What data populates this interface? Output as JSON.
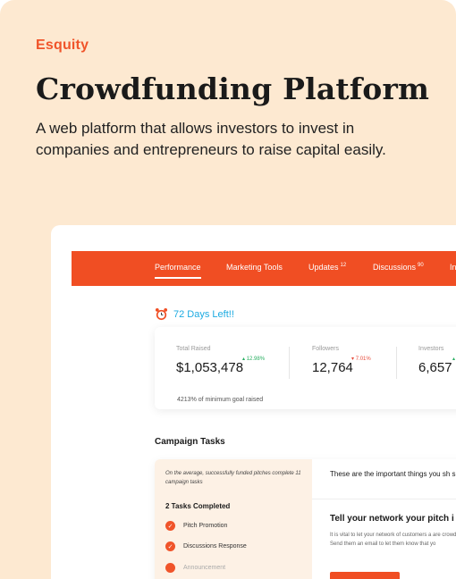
{
  "brand": {
    "logo": "Esquity",
    "accent": "#F04E23",
    "background": "#FDE9D1"
  },
  "hero": {
    "title": "Crowdfunding Platform",
    "description": "A web platform that allows investors to invest in companies and entrepreneurs to raise capital easily."
  },
  "nav": {
    "items": [
      {
        "label": "Performance",
        "badge": ""
      },
      {
        "label": "Marketing Tools",
        "badge": ""
      },
      {
        "label": "Updates",
        "badge": "12"
      },
      {
        "label": "Discussions",
        "badge": "90"
      },
      {
        "label": "In",
        "badge": ""
      }
    ]
  },
  "countdown": {
    "icon": "alarm-clock-icon",
    "text": "72 Days Left!!"
  },
  "stats": {
    "total_raised": {
      "label": "Total Raised",
      "value": "$1,053,478",
      "change": "12.98%",
      "direction": "up"
    },
    "goal_note": "4213% of minimum goal raised",
    "followers": {
      "label": "Followers",
      "value": "12,764",
      "change": "7.01%",
      "direction": "down"
    },
    "investors": {
      "label": "Investors",
      "value": "6,657"
    }
  },
  "tasks": {
    "title": "Campaign Tasks",
    "note": "On the average, successfully funded pitches complete 11 campaign tasks",
    "completed_count": "2 Tasks Completed",
    "items": [
      {
        "label": "Pitch Promotion",
        "done": true
      },
      {
        "label": "Discussions Response",
        "done": true
      },
      {
        "label": "Announcement",
        "done": false
      }
    ],
    "detail": {
      "header": "These are the important things you sh succeed",
      "title": "Tell your network your pitch i",
      "body": "It is vital to let your network of customers a are crowdfunding. Send them an email to let them know that yo"
    }
  }
}
